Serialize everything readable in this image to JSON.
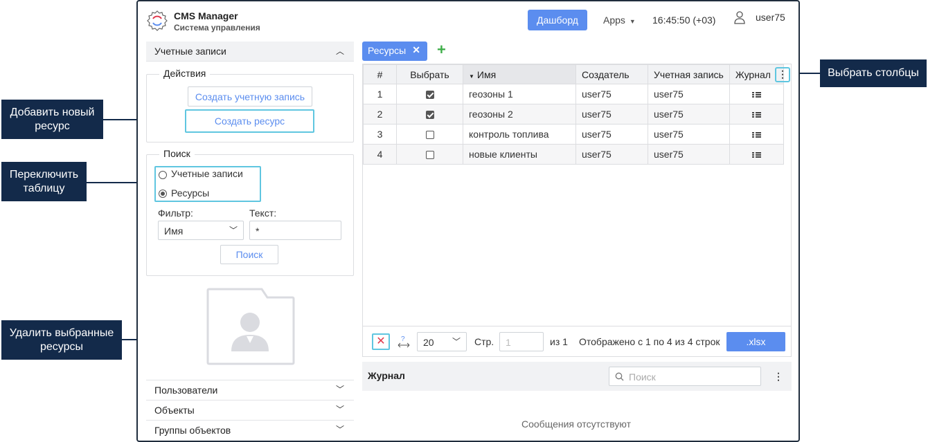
{
  "header": {
    "app_name": "CMS Manager",
    "app_subtitle": "Система управления",
    "dashboard_label": "Дашборд",
    "apps_label": "Apps",
    "time": "16:45:50 (+03)",
    "username": "user75"
  },
  "left": {
    "accounts_header": "Учетные записи",
    "actions_legend": "Действия",
    "create_account_label": "Создать учетную запись",
    "create_resource_label": "Создать ресурс",
    "search_legend": "Поиск",
    "radio_accounts_label": "Учетные записи",
    "radio_resources_label": "Ресурсы",
    "filter_label": "Фильтр:",
    "filter_value": "Имя",
    "text_label": "Текст:",
    "text_value": "*",
    "search_button_label": "Поиск",
    "bottom_sections": [
      {
        "label": "Пользователи"
      },
      {
        "label": "Объекты"
      },
      {
        "label": "Группы объектов"
      }
    ]
  },
  "tabs": [
    {
      "label": "Ресурсы"
    }
  ],
  "table": {
    "columns": [
      "#",
      "Выбрать",
      "Имя",
      "Создатель",
      "Учетная запись",
      "Журнал"
    ],
    "rows": [
      {
        "num": "1",
        "checked": true,
        "name": "геозоны 1",
        "creator": "user75",
        "account": "user75"
      },
      {
        "num": "2",
        "checked": true,
        "name": "геозоны 2",
        "creator": "user75",
        "account": "user75"
      },
      {
        "num": "3",
        "checked": false,
        "name": "контроль топлива",
        "creator": "user75",
        "account": "user75"
      },
      {
        "num": "4",
        "checked": false,
        "name": "новые клиенты",
        "creator": "user75",
        "account": "user75"
      }
    ]
  },
  "paging": {
    "per_page": "20",
    "page_label": "Стр.",
    "page_value": "1",
    "of_label": "из 1",
    "shown_text": "Отображено с 1 по 4 из 4 строк",
    "export_label": ".xlsx"
  },
  "journal": {
    "title": "Журнал",
    "search_placeholder": "Поиск",
    "empty_text": "Сообщения отсутствуют"
  },
  "callouts": {
    "add_resource": "Добавить новый ресурс",
    "switch_table": "Переключить таблицу",
    "delete_selected": "Удалить выбранные ресурсы",
    "choose_columns": "Выбрать столбцы"
  },
  "colors": {
    "accent": "#5b8def",
    "callout_bg": "#132a4a",
    "highlight": "#5fc6e0",
    "delete": "#e0394d",
    "add": "#3fae49"
  }
}
